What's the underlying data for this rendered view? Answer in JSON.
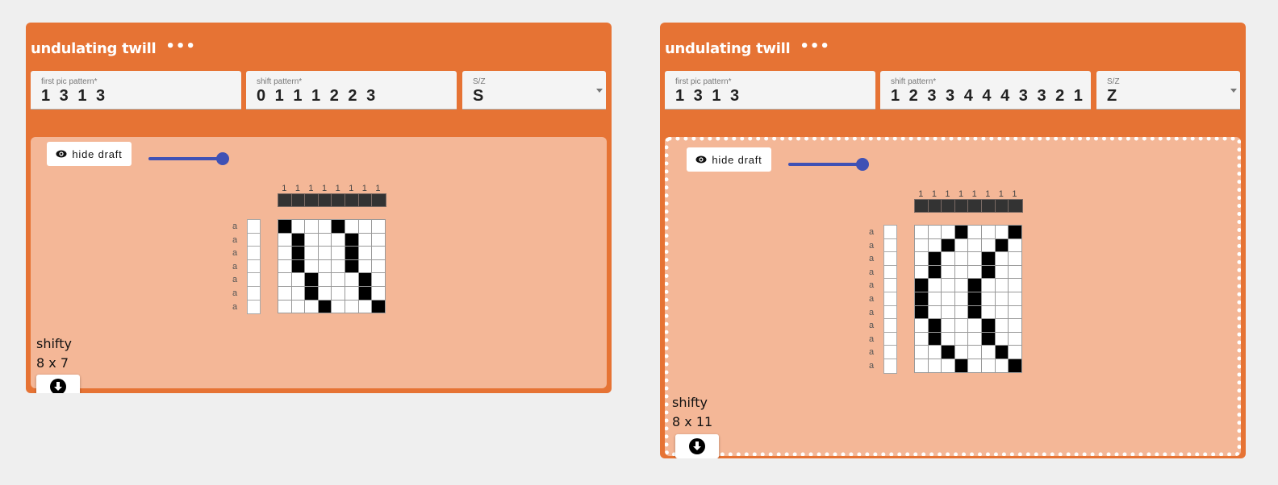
{
  "cards": [
    {
      "title": "undulating twill",
      "more_label": "•••",
      "first_pic": {
        "label": "first pic pattern*",
        "value": "1 3 1 3"
      },
      "shift": {
        "label": "shift pattern*",
        "value": "0 1 1 1 2 2 3"
      },
      "sz": {
        "label": "S/Z",
        "value": "S"
      },
      "hide_draft_label": "hide draft",
      "slider_value": 1.0,
      "selected": false,
      "draft": {
        "cols": 8,
        "rows": 7,
        "col_header": [
          "1",
          "1",
          "1",
          "1",
          "1",
          "1",
          "1",
          "1"
        ],
        "row_labels": [
          "a",
          "a",
          "a",
          "a",
          "a",
          "a",
          "a"
        ],
        "cells_on": [
          [
            1,
            5
          ],
          [
            2,
            6
          ],
          [
            2,
            6
          ],
          [
            2,
            6
          ],
          [
            3,
            7
          ],
          [
            3,
            7
          ],
          [
            4,
            8
          ]
        ]
      },
      "name": "shifty",
      "size": "8 x 7"
    },
    {
      "title": "undulating twill",
      "more_label": "•••",
      "first_pic": {
        "label": "first pic pattern*",
        "value": "1 3 1 3"
      },
      "shift": {
        "label": "shift pattern*",
        "value": "1 2 3 3 4 4 4 3 3 2 1"
      },
      "sz": {
        "label": "S/Z",
        "value": "Z"
      },
      "hide_draft_label": "hide draft",
      "slider_value": 1.0,
      "selected": true,
      "draft": {
        "cols": 8,
        "rows": 11,
        "col_header": [
          "1",
          "1",
          "1",
          "1",
          "1",
          "1",
          "1",
          "1"
        ],
        "row_labels": [
          "a",
          "a",
          "a",
          "a",
          "a",
          "a",
          "a",
          "a",
          "a",
          "a",
          "a"
        ],
        "cells_on": [
          [
            4,
            8
          ],
          [
            3,
            7
          ],
          [
            2,
            6
          ],
          [
            2,
            6
          ],
          [
            1,
            5
          ],
          [
            1,
            5
          ],
          [
            1,
            5
          ],
          [
            2,
            6
          ],
          [
            2,
            6
          ],
          [
            3,
            7
          ],
          [
            4,
            8
          ]
        ]
      },
      "name": "shifty",
      "size": "8 x 11"
    }
  ],
  "icons": {
    "more": "more-horizontal-icon",
    "eye": "eye-icon",
    "download": "download-icon",
    "dropdown": "dropdown-arrow-icon"
  }
}
